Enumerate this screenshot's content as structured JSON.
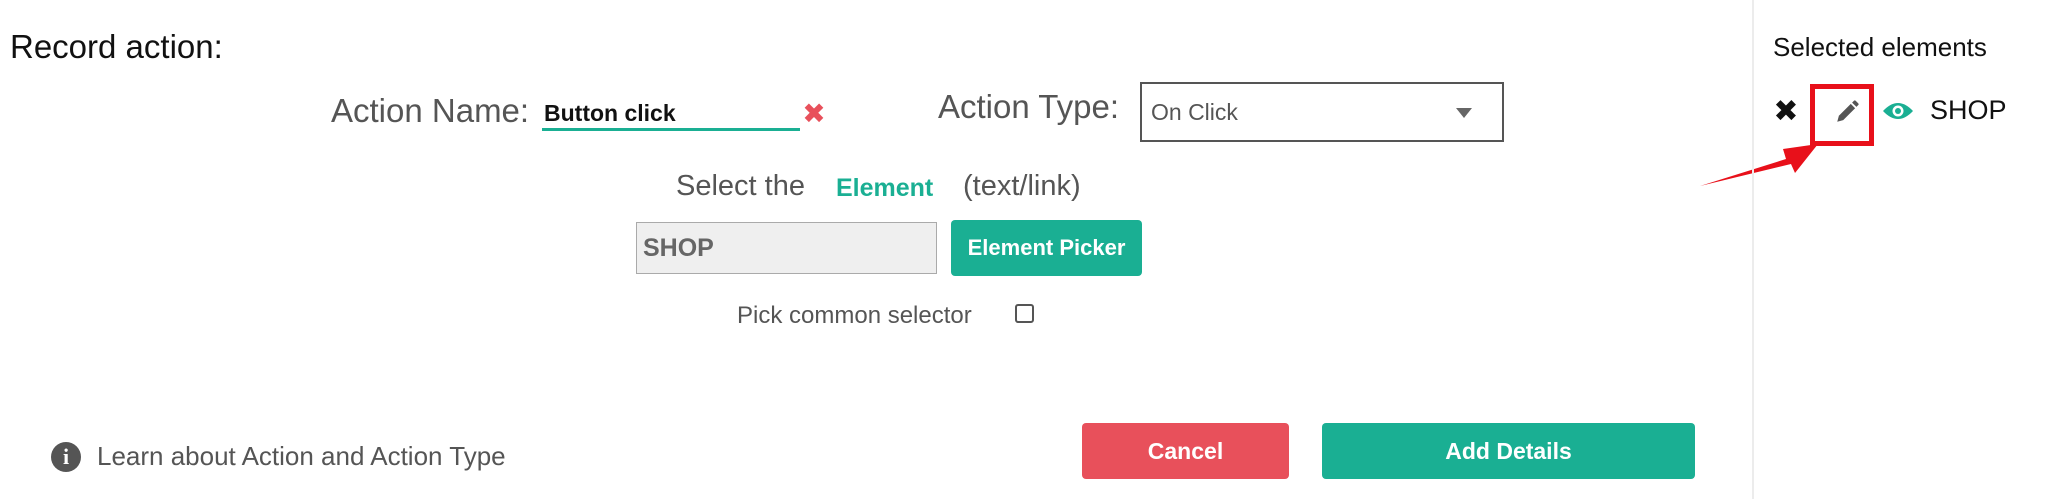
{
  "form": {
    "title": "Record action:",
    "action_name_label": "Action Name:",
    "action_name_value": "Button click",
    "action_type_label": "Action Type:",
    "action_type_value": "On Click",
    "select_prefix": "Select the",
    "select_element_word": "Element",
    "select_suffix": "(text/link)",
    "selector_value": "SHOP",
    "element_picker_label": "Element Picker",
    "common_selector_label": "Pick common selector",
    "common_selector_checked": false,
    "learn_link": "Learn about Action and Action Type",
    "cancel_label": "Cancel",
    "add_details_label": "Add Details"
  },
  "sidebar": {
    "title": "Selected elements",
    "items": [
      {
        "label": "SHOP",
        "icons": [
          "close-icon",
          "pencil-icon",
          "eye-icon"
        ]
      }
    ]
  },
  "colors": {
    "accent": "#1aaf93",
    "danger": "#e8505b",
    "highlight": "#e8101a"
  }
}
